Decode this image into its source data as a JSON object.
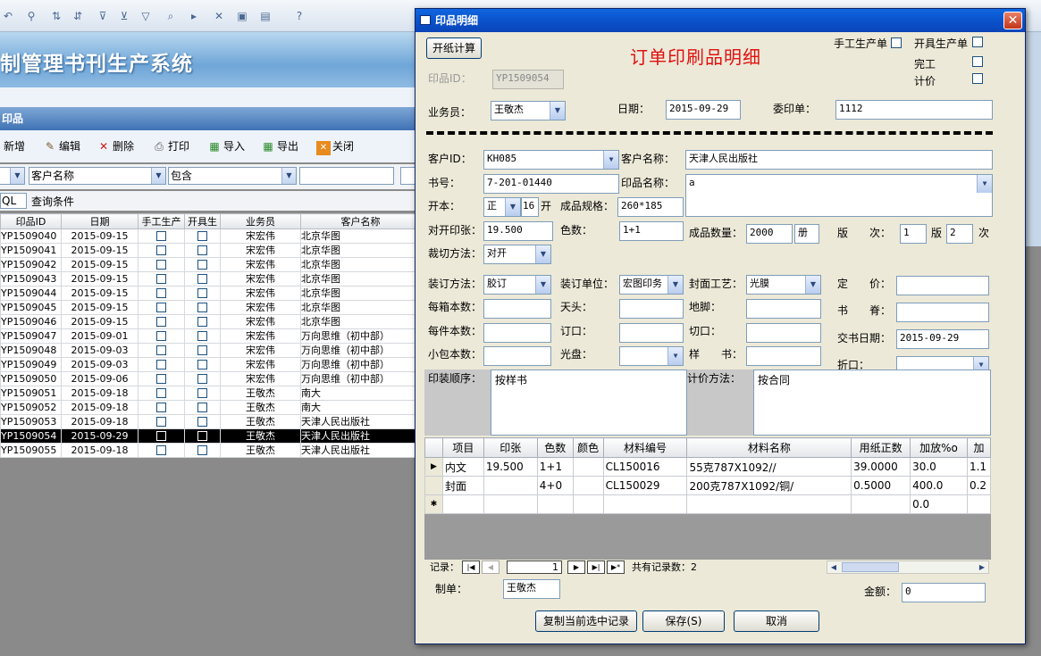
{
  "app": {
    "system_title": "制管理书刊生产系统",
    "section_title": "印品",
    "toolbar": {
      "new": "新增",
      "edit": "编辑",
      "delete": "删除",
      "print": "打印",
      "import": "导入",
      "export": "导出",
      "close": "关闭"
    },
    "filter": {
      "field": "客户名称",
      "op": "包含",
      "value": ""
    },
    "query": {
      "sql": "QL",
      "label": "查询条件"
    },
    "grid": {
      "headers": [
        "印品ID",
        "日期",
        "手工生产",
        "开具生",
        "业务员",
        "客户名称"
      ],
      "rows": [
        {
          "id": "YP1509040",
          "date": "2015-09-15",
          "staff": "宋宏伟",
          "client": "北京华图"
        },
        {
          "id": "YP1509041",
          "date": "2015-09-15",
          "staff": "宋宏伟",
          "client": "北京华图"
        },
        {
          "id": "YP1509042",
          "date": "2015-09-15",
          "staff": "宋宏伟",
          "client": "北京华图"
        },
        {
          "id": "YP1509043",
          "date": "2015-09-15",
          "staff": "宋宏伟",
          "client": "北京华图"
        },
        {
          "id": "YP1509044",
          "date": "2015-09-15",
          "staff": "宋宏伟",
          "client": "北京华图"
        },
        {
          "id": "YP1509045",
          "date": "2015-09-15",
          "staff": "宋宏伟",
          "client": "北京华图"
        },
        {
          "id": "YP1509046",
          "date": "2015-09-15",
          "staff": "宋宏伟",
          "client": "北京华图"
        },
        {
          "id": "YP1509047",
          "date": "2015-09-01",
          "staff": "宋宏伟",
          "client": "万向思维（初中部）"
        },
        {
          "id": "YP1509048",
          "date": "2015-09-03",
          "staff": "宋宏伟",
          "client": "万向思维（初中部）"
        },
        {
          "id": "YP1509049",
          "date": "2015-09-03",
          "staff": "宋宏伟",
          "client": "万向思维（初中部）"
        },
        {
          "id": "YP1509050",
          "date": "2015-09-06",
          "staff": "宋宏伟",
          "client": "万向思维（初中部）"
        },
        {
          "id": "YP1509051",
          "date": "2015-09-18",
          "staff": "王敬杰",
          "client": "南大"
        },
        {
          "id": "YP1509052",
          "date": "2015-09-18",
          "staff": "王敬杰",
          "client": "南大"
        },
        {
          "id": "YP1509053",
          "date": "2015-09-18",
          "staff": "王敬杰",
          "client": "天津人民出版社"
        },
        {
          "id": "YP1509054",
          "date": "2015-09-29",
          "staff": "王敬杰",
          "client": "天津人民出版社"
        },
        {
          "id": "YP1509055",
          "date": "2015-09-18",
          "staff": "王敬杰",
          "client": "天津人民出版社"
        }
      ]
    }
  },
  "dialog": {
    "title": "印品明细",
    "calc_button": "开纸计算",
    "heading": "订单印刷品明细",
    "checks": {
      "manual": "手工生产单",
      "open": "开具生产单",
      "done": "完工",
      "price": "计价"
    },
    "print_id_label": "印品ID：",
    "print_id": "YP1509054",
    "staff_label": "业务员：",
    "staff": "王敬杰",
    "date_label": "日期：",
    "date": "2015-09-29",
    "order_label": "委印单：",
    "order": "1112",
    "client_id_label": "客户ID：",
    "client_id": "KH085",
    "client_name_label": "客户名称：",
    "client_name": "天津人民出版社",
    "book_no_label": "书号：",
    "book_no": "7-201-01440",
    "print_name_label": "印品名称：",
    "print_name": "a",
    "format_label": "开本：",
    "format_type": "正",
    "format_num": "16",
    "format_unit": "开",
    "size_label": "成品规格：",
    "size": "260*185",
    "sheets_label": "对开印张：",
    "sheets": "19.500",
    "color_label": "色数：",
    "color": "1+1",
    "qty_label": "成品数量：",
    "qty": "2000",
    "qty_unit": "册",
    "edition_label": "版　　次：",
    "edition": "1",
    "edition_mid": "版",
    "times": "2",
    "times_unit": "次",
    "cut_label": "裁切方法：",
    "cut": "对开",
    "binding_label": "装订方法：",
    "binding": "胶订",
    "bind_unit_label": "装订单位：",
    "bind_unit": "宏图印务",
    "cover_label": "封面工艺：",
    "cover": "光膜",
    "price_label": "定　　价：",
    "price": "",
    "per_box_label": "每箱本数：",
    "head_label": "天头：",
    "foot_label": "地脚：",
    "spine_label": "书　　脊：",
    "per_piece_label": "每件本数：",
    "gutter_label": "订口：",
    "cutmouth_label": "切口：",
    "delivery_label": "交书日期：",
    "delivery": "2015-09-29",
    "small_pack_label": "小包本数：",
    "disc_label": "光盘：",
    "sample_label": "样　　书：",
    "fold_label": "折口：",
    "order_seq_label": "印装顺序：",
    "order_seq": "按样书",
    "pricing_label": "计价方法：",
    "pricing": "按合同",
    "sub": {
      "headers": [
        "项目",
        "印张",
        "色数",
        "颜色",
        "材料编号",
        "材料名称",
        "用纸正数",
        "加放%o",
        "加"
      ],
      "rows": [
        [
          "内文",
          "19.500",
          "1+1",
          "",
          "CL150016",
          "55克787X1092//",
          "39.0000",
          "30.0",
          "1.1"
        ],
        [
          "封面",
          "",
          "4+0",
          "",
          "CL150029",
          "200克787X1092/铜/",
          "0.5000",
          "400.0",
          "0.2"
        ],
        [
          "",
          "",
          "",
          "",
          "",
          "",
          "",
          "0.0",
          ""
        ]
      ],
      "nav_label": "记录：",
      "nav_current": "1",
      "nav_total": "共有记录数：2"
    },
    "maker_label": "制单：",
    "maker": "王敬杰",
    "amount_label": "金额：",
    "amount": "0",
    "copy_button": "复制当前选中记录",
    "save_button": "保存(S)",
    "cancel_button": "取消"
  }
}
